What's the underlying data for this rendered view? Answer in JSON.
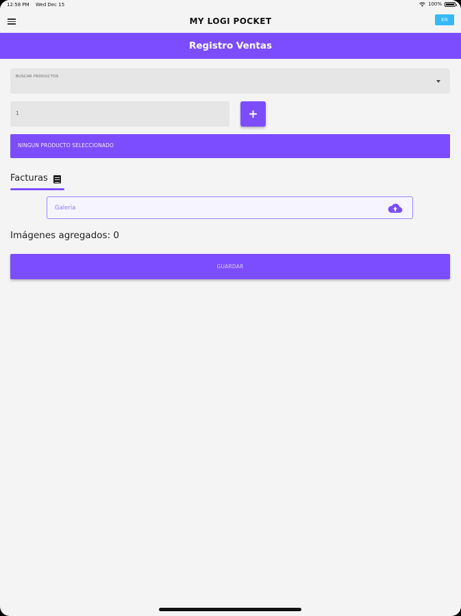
{
  "status_bar": {
    "time": "12:58 PM",
    "date": "Wed Dec 15",
    "battery": "100%"
  },
  "app_bar": {
    "title": "MY LOGI POCKET",
    "lang_button": "EN",
    "menu_icon": "hamburger-menu-icon"
  },
  "header": {
    "title": "Registro Ventas"
  },
  "form": {
    "search_label": "BUSCAR PRODUCTOS",
    "quantity_value": "1",
    "add_button_label": "+",
    "no_product_text": "NINGUN PRODUCTO SELECCIONADO"
  },
  "tabs": [
    {
      "label": "Facturas",
      "icon": "receipt-icon",
      "active": true
    }
  ],
  "gallery": {
    "placeholder": "Galeria",
    "icon": "cloud-upload-icon"
  },
  "images_count_text": "Imágenes agregados: 0",
  "save_button_label": "GUARDAR",
  "colors": {
    "accent": "#7c4dff",
    "background": "#f4f4f5",
    "field": "#e6e6e7",
    "lang_button": "#37b8f5"
  }
}
